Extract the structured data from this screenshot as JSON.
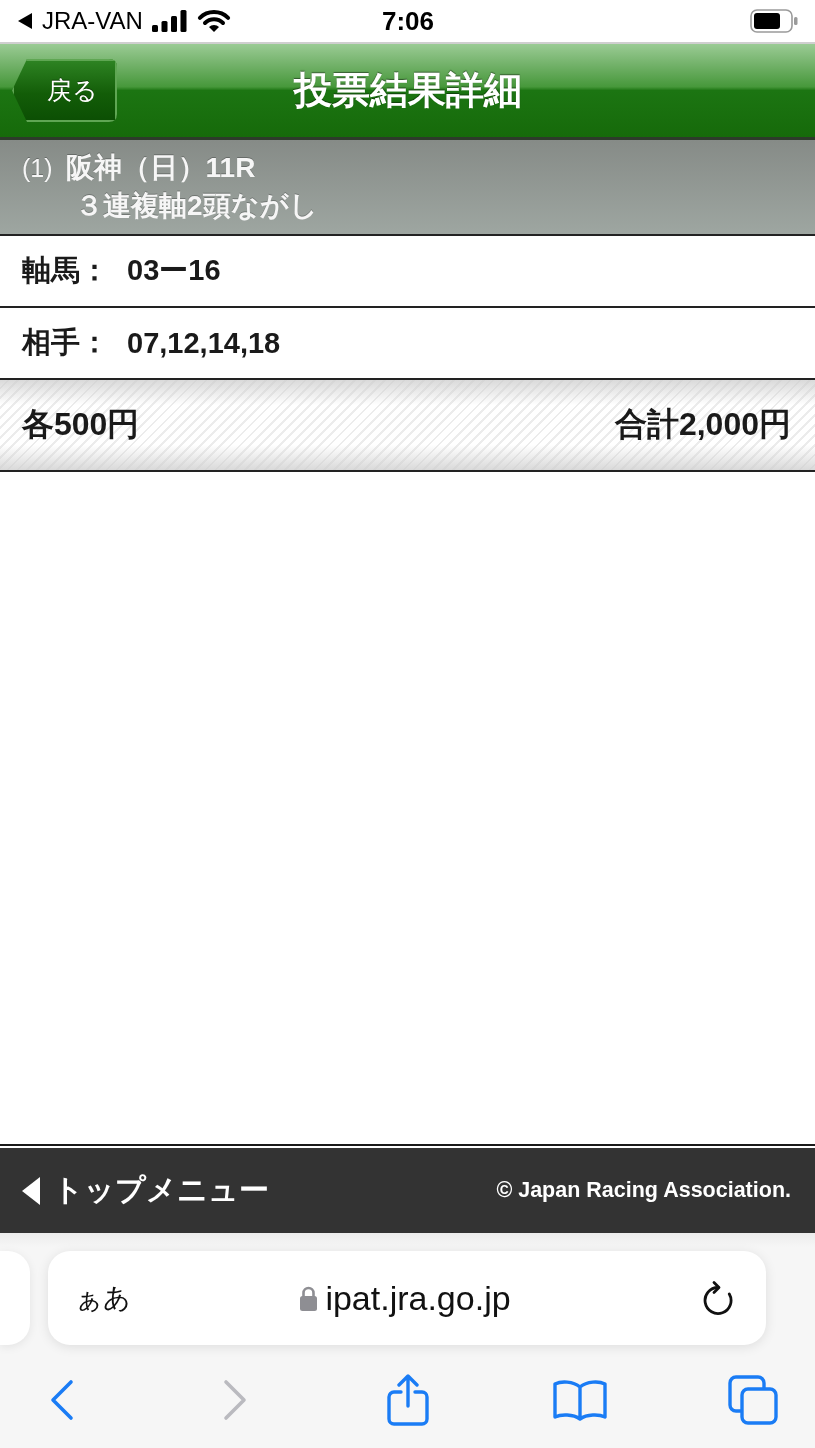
{
  "status_bar": {
    "back_app": "JRA-VAN",
    "time": "7:06"
  },
  "header": {
    "back_button": "戻る",
    "title": "投票結果詳細"
  },
  "race": {
    "number": "(1)",
    "name": "阪神（日）11R",
    "bet_type": "３連複軸2頭ながし"
  },
  "details": [
    {
      "label": "軸馬：",
      "value": "03ー16"
    },
    {
      "label": "相手：",
      "value": "07,12,14,18"
    }
  ],
  "summary": {
    "per_bet": "各500円",
    "total": "合計2,000円"
  },
  "footer": {
    "top_menu_link": "トップメニュー",
    "copyright": "© Japan Racing Association."
  },
  "browser": {
    "text_size_button": "ぁあ",
    "url": "ipat.jra.go.jp",
    "toolbar": [
      {
        "kind": "back",
        "disabled": false
      },
      {
        "kind": "forward",
        "disabled": true
      },
      {
        "kind": "share",
        "disabled": false
      },
      {
        "kind": "bookmarks",
        "disabled": false
      },
      {
        "kind": "tabs",
        "disabled": false
      }
    ]
  }
}
